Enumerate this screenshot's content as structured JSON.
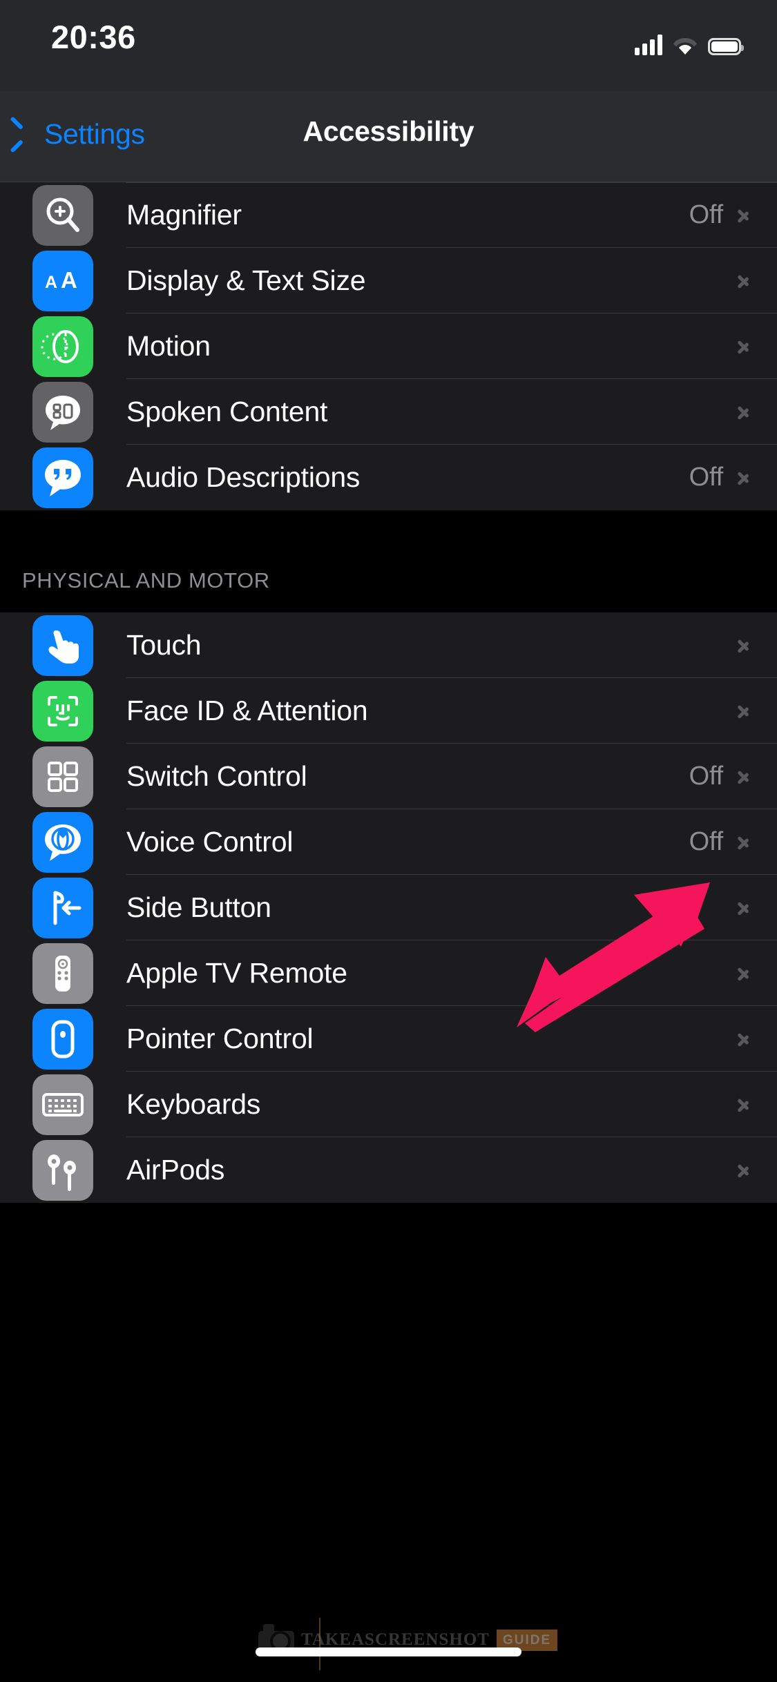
{
  "status_bar": {
    "time": "20:36",
    "signal_icon": "cellular-bars-icon",
    "wifi_icon": "wifi-icon",
    "battery_icon": "battery-full-icon"
  },
  "nav_bar": {
    "back_label": "Settings",
    "back_icon": "chevron-left-icon",
    "title": "Accessibility"
  },
  "colors": {
    "accent_blue": "#0a84ff",
    "icon_blue": "#0b84fe",
    "icon_green": "#30d158",
    "icon_gray": "#8e8e93",
    "icon_dark_gray": "#636366",
    "row_background": "#1c1c1e",
    "section_background": "#000000",
    "separator": "#38383a",
    "secondary_text": "#8e8e93",
    "annotation_arrow": "#f4155c"
  },
  "sections": [
    {
      "header": "",
      "rows": [
        {
          "label": "Magnifier",
          "value": "Off",
          "icon": "magnifier-icon",
          "icon_color": "dark-gray",
          "chevron": "chevron-right-icon"
        },
        {
          "label": "Display & Text Size",
          "value": "",
          "icon": "display-text-size-icon",
          "icon_color": "blue",
          "chevron": "chevron-right-icon"
        },
        {
          "label": "Motion",
          "value": "",
          "icon": "motion-icon",
          "icon_color": "green",
          "chevron": "chevron-right-icon"
        },
        {
          "label": "Spoken Content",
          "value": "",
          "icon": "spoken-content-icon",
          "icon_color": "dark-gray",
          "chevron": "chevron-right-icon"
        },
        {
          "label": "Audio Descriptions",
          "value": "Off",
          "icon": "audio-descriptions-icon",
          "icon_color": "blue",
          "chevron": "chevron-right-icon"
        }
      ]
    },
    {
      "header": "PHYSICAL AND MOTOR",
      "rows": [
        {
          "label": "Touch",
          "value": "",
          "icon": "touch-hand-icon",
          "icon_color": "blue",
          "chevron": "chevron-right-icon"
        },
        {
          "label": "Face ID & Attention",
          "value": "",
          "icon": "face-id-icon",
          "icon_color": "green",
          "chevron": "chevron-right-icon"
        },
        {
          "label": "Switch Control",
          "value": "Off",
          "icon": "switch-control-icon",
          "icon_color": "gray",
          "chevron": "chevron-right-icon"
        },
        {
          "label": "Voice Control",
          "value": "Off",
          "icon": "voice-control-icon",
          "icon_color": "blue",
          "chevron": "chevron-right-icon"
        },
        {
          "label": "Side Button",
          "value": "",
          "icon": "side-button-icon",
          "icon_color": "blue",
          "chevron": "chevron-right-icon"
        },
        {
          "label": "Apple TV Remote",
          "value": "",
          "icon": "apple-tv-remote-icon",
          "icon_color": "gray",
          "chevron": "chevron-right-icon"
        },
        {
          "label": "Pointer Control",
          "value": "",
          "icon": "pointer-control-icon",
          "icon_color": "blue",
          "chevron": "chevron-right-icon"
        },
        {
          "label": "Keyboards",
          "value": "",
          "icon": "keyboard-icon",
          "icon_color": "gray",
          "chevron": "chevron-right-icon"
        },
        {
          "label": "AirPods",
          "value": "",
          "icon": "airpods-icon",
          "icon_color": "gray",
          "chevron": "chevron-right-icon"
        }
      ]
    }
  ],
  "annotation": {
    "type": "arrow",
    "points_to": "Touch row disclosure chevron",
    "color": "#f4155c"
  },
  "watermark": {
    "text": "TAKEASCREENSHOT",
    "badge": "GUIDE",
    "logo_icon": "camera-icon"
  },
  "home_indicator": {
    "icon": "home-indicator-bar"
  }
}
